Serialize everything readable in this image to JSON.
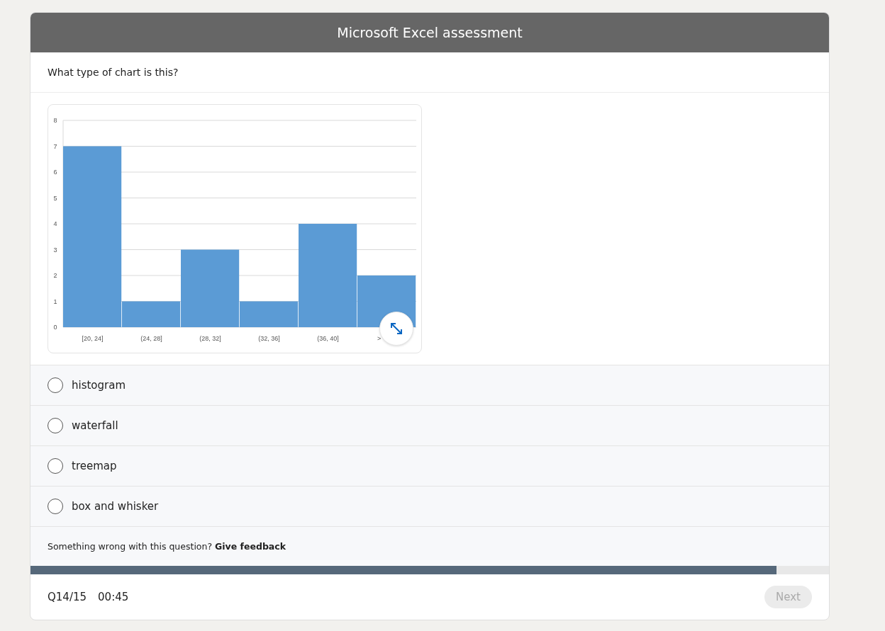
{
  "header": {
    "title": "Microsoft Excel assessment"
  },
  "question": {
    "text": "What type of chart is this?",
    "chart_data": {
      "type": "bar",
      "categories": [
        "[20, 24]",
        "(24, 28]",
        "(28, 32]",
        "(32, 36]",
        "(36, 40]",
        ">"
      ],
      "series": [
        {
          "color": "#5b9bd5",
          "values": [
            7,
            1,
            3,
            1,
            4,
            2
          ]
        }
      ],
      "grid": true,
      "ylim": [
        0,
        8
      ],
      "yticks": [
        0,
        1,
        2,
        3,
        4,
        5,
        6,
        7,
        8
      ]
    }
  },
  "options": [
    {
      "label": "histogram",
      "selected": false
    },
    {
      "label": "waterfall",
      "selected": false
    },
    {
      "label": "treemap",
      "selected": false
    },
    {
      "label": "box and whisker",
      "selected": false
    }
  ],
  "feedback": {
    "text": "Something wrong with this question?",
    "link": "Give feedback"
  },
  "progress": {
    "level": 0.934
  },
  "footer": {
    "counter": "Q14/15",
    "timer": "00:45",
    "next_button": {
      "label": "Next",
      "disabled": true
    }
  }
}
